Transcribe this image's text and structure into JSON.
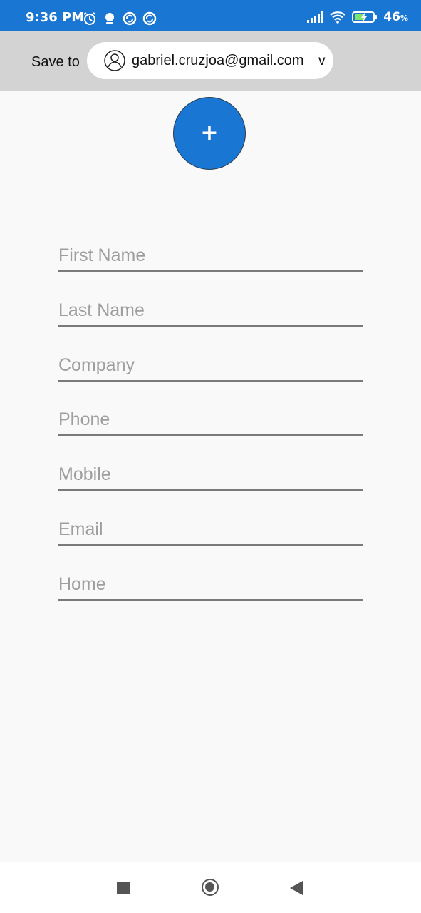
{
  "status_bar": {
    "time": "9:36 PM",
    "battery_percent": "46",
    "battery_unit": "%",
    "icons_left": [
      "alarm-icon",
      "notification-icon",
      "sync-icon",
      "sync-icon"
    ],
    "icons_right": [
      "signal-icon",
      "wifi-icon",
      "battery-charging-icon"
    ]
  },
  "save_bar": {
    "label": "Save to",
    "account_email": "gabriel.cruzjoa@gmail.com",
    "chevron": "v"
  },
  "photo_button": {
    "icon": "+"
  },
  "form": {
    "fields": [
      {
        "placeholder": "First Name",
        "value": ""
      },
      {
        "placeholder": "Last Name",
        "value": ""
      },
      {
        "placeholder": "Company",
        "value": ""
      },
      {
        "placeholder": "Phone",
        "value": ""
      },
      {
        "placeholder": "Mobile",
        "value": ""
      },
      {
        "placeholder": "Email",
        "value": ""
      },
      {
        "placeholder": "Home",
        "value": ""
      }
    ]
  },
  "colors": {
    "accent": "#1976d2",
    "save_bar_bg": "#d3d3d3",
    "page_bg": "#f9f9f9",
    "placeholder": "#9e9e9e"
  },
  "nav_bar": {
    "buttons": [
      "recent-apps-icon",
      "home-icon",
      "back-icon"
    ]
  }
}
